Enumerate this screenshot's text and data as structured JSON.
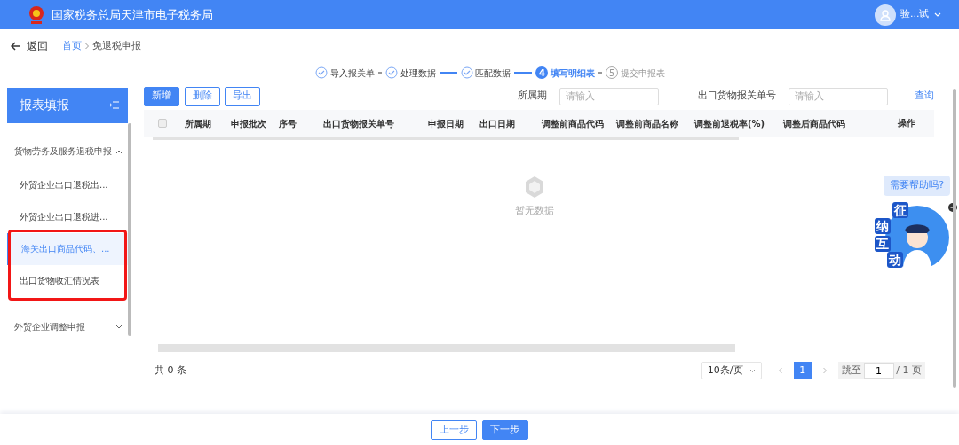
{
  "header": {
    "title": "国家税务总局天津市电子税务局",
    "user": "验...试"
  },
  "nav": {
    "back": "返回",
    "breadcrumb": [
      {
        "label": "首页",
        "link": true
      },
      {
        "label": "免退税申报",
        "link": false
      }
    ]
  },
  "steps": [
    {
      "label": "导入报关单",
      "done": true,
      "active": false
    },
    {
      "label": "处理数据",
      "done": true,
      "active": false
    },
    {
      "label": "匹配数据",
      "done": true,
      "active": false
    },
    {
      "number": "4",
      "label": "填写明细表",
      "done": false,
      "active": true
    },
    {
      "number": "5",
      "label": "提交申报表",
      "done": false,
      "active": false
    }
  ],
  "sidebar": {
    "title": "报表填报",
    "groups": [
      {
        "label": "货物劳务及服务退税申报",
        "expanded": true,
        "children": [
          {
            "label": "外贸企业出口退税出...",
            "selected": false,
            "flagged": false
          },
          {
            "label": "外贸企业出口退税进...",
            "selected": false,
            "flagged": false
          },
          {
            "label": "海关出口商品代码、...",
            "selected": true,
            "flagged": true
          },
          {
            "label": "出口货物收汇情况表",
            "selected": false,
            "flagged": true
          }
        ]
      },
      {
        "label": "外贸企业调整申报",
        "expanded": false
      }
    ]
  },
  "toolbar": {
    "buttons": [
      {
        "label": "新增",
        "primary": true
      },
      {
        "label": "删除",
        "primary": false
      },
      {
        "label": "导出",
        "primary": false
      }
    ],
    "filters": [
      {
        "label": "所属期",
        "placeholder": "请输入"
      },
      {
        "label": "出口货物报关单号",
        "placeholder": "请输入"
      }
    ],
    "query": "查询"
  },
  "table": {
    "select_all": {
      "checked": false
    },
    "columns": [
      "所属期",
      "申报批次",
      "序号",
      "出口货物报关单号",
      "申报日期",
      "出口日期",
      "调整前商品代码",
      "调整前商品名称",
      "调整前退税率(%)",
      "调整后商品代码"
    ],
    "action_column": "操作",
    "empty": "暂无数据"
  },
  "pagination": {
    "total": "共 0 条",
    "page_size": "10条/页",
    "pages": [
      {
        "label": "1",
        "selected": true
      }
    ],
    "jump_label": "跳至",
    "jump_value": "1",
    "page_count": "/ 1 页"
  },
  "help": {
    "bubble": "需要帮助吗?",
    "badge": [
      "征",
      "纳",
      "互",
      "动"
    ]
  },
  "footer": {
    "buttons": [
      {
        "label": "上一步",
        "primary": false
      },
      {
        "label": "下一步",
        "primary": true
      }
    ]
  }
}
